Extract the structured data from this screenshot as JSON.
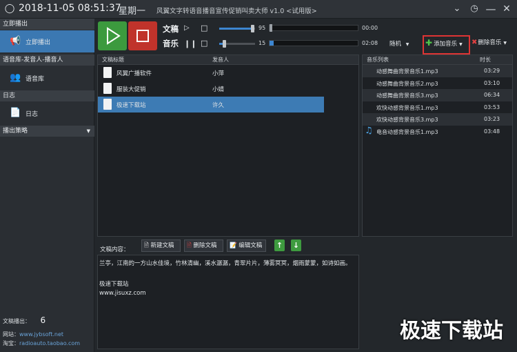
{
  "title_bar": {
    "datetime": "2018-11-05 08:51:37",
    "weekday": "星期一",
    "app_title": "风翼文字转语音播音宣传促销叫卖大师 v1.0 <试用版>"
  },
  "sidebar": {
    "sections": [
      {
        "header": "立即播出",
        "item_label": "立即播出",
        "icon": "megaphone-icon"
      },
      {
        "header": "语音库-发音人-播音人",
        "item_label": "语音库",
        "icon": "people-icon"
      },
      {
        "header": "日志",
        "item_label": "日志",
        "icon": "document-icon"
      },
      {
        "header": "播出策略",
        "icon": "chevron-down-icon"
      }
    ],
    "footer": {
      "count_label": "文稿播出：",
      "count_value": "6",
      "website_label": "网站：",
      "website_value": "www.jybsoft.net",
      "taobao_label": "淘宝：",
      "taobao_value": "radioauto.taobao.com"
    }
  },
  "controls": {
    "doc_label": "文稿",
    "music_label": "音乐",
    "doc_volume": "95",
    "music_volume": "15",
    "doc_time": "00:00",
    "music_time": "02:08",
    "doc_volume_level": 0.95,
    "music_volume_level": 0.15,
    "music_progress": 0.05,
    "play_mode": "随机",
    "add_music": "添加音乐",
    "delete_music": "删除音乐",
    "play_color": "#3c9a3e",
    "stop_color": "#c0332b"
  },
  "doc_table": {
    "col_title": "文稿标题",
    "col_speaker": "发音人",
    "rows": [
      {
        "title": "风翼广播软件",
        "speaker": "小萍"
      },
      {
        "title": "服装大促销",
        "speaker": "小婧"
      },
      {
        "title": "极速下载站",
        "speaker": "许久"
      }
    ]
  },
  "music_table": {
    "col_name": "音乐列表",
    "col_duration": "时长",
    "rows": [
      {
        "name": "动感舞曲背景音乐1.mp3",
        "duration": "03:29"
      },
      {
        "name": "动感舞曲背景音乐2.mp3",
        "duration": "03:10"
      },
      {
        "name": "动感舞曲背景音乐3.mp3",
        "duration": "06:34"
      },
      {
        "name": "欢快动感背景音乐1.mp3",
        "duration": "03:53"
      },
      {
        "name": "欢快动感背景音乐3.mp3",
        "duration": "03:23"
      },
      {
        "name": "电音动感背景音乐1.mp3",
        "duration": "03:48"
      }
    ]
  },
  "content": {
    "label": "文稿内容：",
    "new_doc": "新建文稿",
    "delete_doc": "删除文稿",
    "edit_doc": "编辑文稿",
    "lines": [
      "兰亭，江南的一方山水佳境，竹林清幽，溪水潺潺，青翠片片，薄雾冥冥，烟雨蒙蒙，如诗如画。",
      "",
      "极速下载站",
      "www.jisuxz.com"
    ]
  },
  "watermark": "极速下载站"
}
